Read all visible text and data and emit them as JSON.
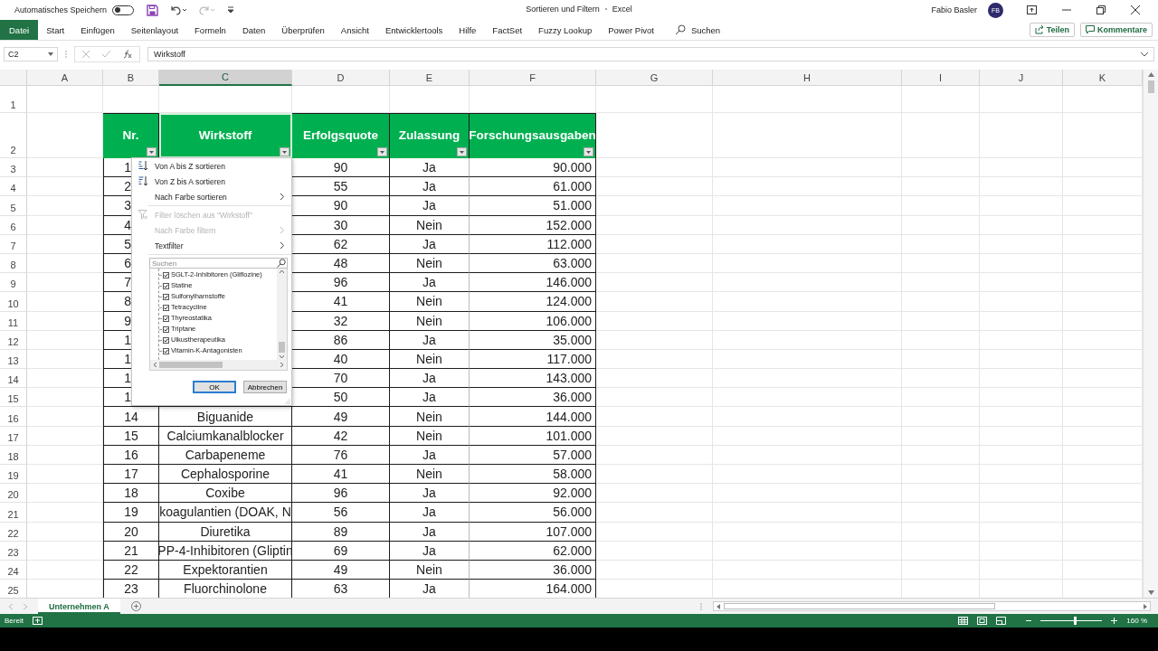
{
  "title_bar": {
    "autosave_label": "Automatisches Speichern",
    "autosave_on": false,
    "title": "Sortieren und Filtern",
    "app": "Excel",
    "user": "Fabio Basler",
    "avatar": "FB"
  },
  "ribbon": {
    "tabs": [
      {
        "label": "Datei",
        "kind": "file",
        "selected": false
      },
      {
        "label": "Start",
        "kind": "tab",
        "selected": false
      },
      {
        "label": "Einfügen",
        "kind": "tab",
        "selected": false
      },
      {
        "label": "Seitenlayout",
        "kind": "tab",
        "selected": false
      },
      {
        "label": "Formeln",
        "kind": "tab",
        "selected": false
      },
      {
        "label": "Daten",
        "kind": "tab",
        "selected": false
      },
      {
        "label": "Überprüfen",
        "kind": "tab",
        "selected": false
      },
      {
        "label": "Ansicht",
        "kind": "tab",
        "selected": false
      },
      {
        "label": "Entwicklertools",
        "kind": "tab",
        "selected": false
      },
      {
        "label": "Hilfe",
        "kind": "tab",
        "selected": false
      },
      {
        "label": "FactSet",
        "kind": "tab",
        "selected": false
      },
      {
        "label": "Fuzzy Lookup",
        "kind": "tab",
        "selected": false
      },
      {
        "label": "Power Pivot",
        "kind": "tab",
        "selected": false
      }
    ],
    "search": {
      "placeholder": "Suchen"
    },
    "share_button": "Teilen",
    "comments_button": "Kommentare"
  },
  "formula_bar": {
    "name_box": "C2",
    "formula": "Wirkstoff"
  },
  "sheet": {
    "columns": [
      {
        "label": "A",
        "selected": false
      },
      {
        "label": "B",
        "selected": false
      },
      {
        "label": "C",
        "selected": true
      },
      {
        "label": "D",
        "selected": false
      },
      {
        "label": "E",
        "selected": false
      },
      {
        "label": "F",
        "selected": false
      },
      {
        "label": "G",
        "selected": false
      },
      {
        "label": "H",
        "selected": false
      },
      {
        "label": "I",
        "selected": false
      },
      {
        "label": "J",
        "selected": false
      },
      {
        "label": "K",
        "selected": false
      }
    ],
    "row_numbers": [
      "1",
      "2",
      "3",
      "4",
      "5",
      "6",
      "7",
      "8",
      "9",
      "10",
      "11",
      "12",
      "13",
      "14",
      "15",
      "16",
      "17",
      "18",
      "19",
      "20",
      "21",
      "22",
      "23",
      "24",
      "25"
    ],
    "headers": [
      "Nr.",
      "Wirkstoff",
      "Erfolgsquote",
      "Zulassung",
      "Forschungsausgaben"
    ],
    "rows": [
      {
        "nr": "1",
        "quote": "90",
        "approval": "Ja",
        "spend": "90.000"
      },
      {
        "nr": "2",
        "quote": "55",
        "approval": "Ja",
        "spend": "61.000"
      },
      {
        "nr": "3",
        "quote": "90",
        "approval": "Ja",
        "spend": "51.000"
      },
      {
        "nr": "4",
        "quote": "30",
        "approval": "Nein",
        "spend": "152.000"
      },
      {
        "nr": "5",
        "quote": "62",
        "approval": "Ja",
        "spend": "112.000"
      },
      {
        "nr": "6",
        "quote": "48",
        "approval": "Nein",
        "spend": "63.000"
      },
      {
        "nr": "7",
        "quote": "96",
        "approval": "Ja",
        "spend": "146.000"
      },
      {
        "nr": "8",
        "quote": "41",
        "approval": "Nein",
        "spend": "124.000"
      },
      {
        "nr": "9",
        "quote": "32",
        "approval": "Nein",
        "spend": "106.000"
      },
      {
        "nr": "1",
        "quote": "86",
        "approval": "Ja",
        "spend": "35.000"
      },
      {
        "nr": "1",
        "quote": "40",
        "approval": "Nein",
        "spend": "117.000"
      },
      {
        "nr": "1",
        "quote": "70",
        "approval": "Ja",
        "spend": "143.000"
      },
      {
        "nr": "1",
        "quote": "50",
        "approval": "Ja",
        "spend": "36.000"
      },
      {
        "nr": "14",
        "substance": "Biguanide",
        "quote": "49",
        "approval": "Nein",
        "spend": "144.000"
      },
      {
        "nr": "15",
        "substance": "Calciumkanalblocker",
        "quote": "42",
        "approval": "Nein",
        "spend": "101.000"
      },
      {
        "nr": "16",
        "substance": "Carbapeneme",
        "quote": "76",
        "approval": "Ja",
        "spend": "57.000"
      },
      {
        "nr": "17",
        "substance": "Cephalosporine",
        "quote": "41",
        "approval": "Nein",
        "spend": "58.000"
      },
      {
        "nr": "18",
        "substance": "Coxibe",
        "quote": "96",
        "approval": "Ja",
        "spend": "92.000"
      },
      {
        "nr": "19",
        "substance": "koagulantien (DOAK, N",
        "quote": "56",
        "approval": "Ja",
        "spend": "56.000"
      },
      {
        "nr": "20",
        "substance": "Diuretika",
        "quote": "89",
        "approval": "Ja",
        "spend": "107.000"
      },
      {
        "nr": "21",
        "substance": "PP-4-Inhibitoren (Gliptin",
        "quote": "69",
        "approval": "Ja",
        "spend": "62.000"
      },
      {
        "nr": "22",
        "substance": "Expektorantien",
        "quote": "49",
        "approval": "Nein",
        "spend": "36.000"
      },
      {
        "nr": "23",
        "substance": "Fluorchinolone",
        "quote": "63",
        "approval": "Ja",
        "spend": "164.000"
      }
    ]
  },
  "filter_menu": {
    "items": [
      {
        "kind": "sort_az",
        "label": "Von A bis Z sortieren",
        "disabled": false
      },
      {
        "kind": "sort_za",
        "label": "Von Z bis A sortieren",
        "disabled": false
      },
      {
        "kind": "submenu",
        "label": "Nach Farbe sortieren",
        "disabled": false
      },
      {
        "kind": "clear_filter",
        "label": "Filter löschen aus \"Wirkstoff\"",
        "disabled": true
      },
      {
        "kind": "submenu",
        "label": "Nach Farbe filtern",
        "disabled": true
      },
      {
        "kind": "submenu",
        "label": "Textfilter",
        "disabled": false
      }
    ],
    "search": {
      "placeholder": "Suchen"
    },
    "values": [
      {
        "label": "SGLT-2-Inhibitoren (Gliflozine)",
        "checked": true
      },
      {
        "label": "Statine",
        "checked": true
      },
      {
        "label": "Sulfonylharnstoffe",
        "checked": true
      },
      {
        "label": "Tetracycline",
        "checked": true
      },
      {
        "label": "Thyreostatika",
        "checked": true
      },
      {
        "label": "Triptane",
        "checked": true
      },
      {
        "label": "Ulkustherapeutika",
        "checked": true
      },
      {
        "label": "Vitamin-K-Antagonisten",
        "checked": true
      }
    ],
    "buttons": [
      {
        "label": "OK",
        "default": true
      },
      {
        "label": "Abbrechen",
        "default": false
      }
    ]
  },
  "sheet_tabs": [
    {
      "label": "Unternehmen A",
      "selected": true
    }
  ],
  "status_bar": {
    "status": "Bereit",
    "zoom": "160 %",
    "zoom_slider": {
      "level": 0.56
    }
  }
}
